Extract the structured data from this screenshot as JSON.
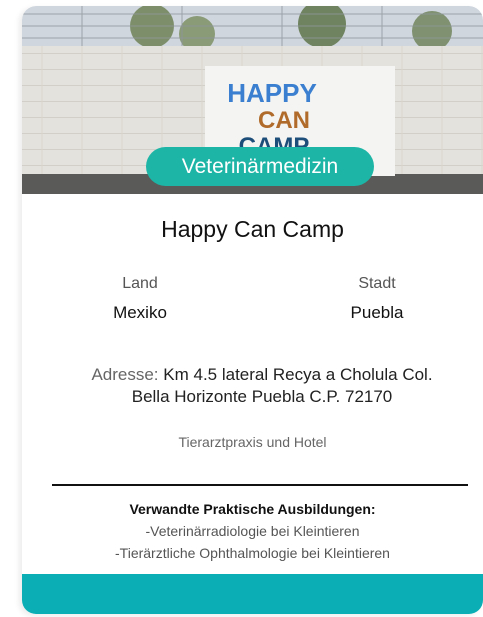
{
  "hero": {
    "sign_lines": [
      "HAPPY",
      "CAN",
      "CAMP"
    ],
    "badge_label": "Veterinärmedizin"
  },
  "title": "Happy Can Camp",
  "details": {
    "country_label": "Land",
    "country_value": "Mexiko",
    "city_label": "Stadt",
    "city_value": "Puebla"
  },
  "address": {
    "label": "Adresse:",
    "line1": "Km 4.5 lateral Recya a Cholula Col.",
    "line2": "Bella Horizonte Puebla C.P. 72170"
  },
  "practice_type": "Tierarztpraxis und Hotel",
  "related": {
    "title": "Verwandte Praktische Ausbildungen:",
    "items": [
      "-Veterinärradiologie bei Kleintieren",
      "-Tierärztliche Ophthalmologie bei Kleintieren"
    ]
  },
  "colors": {
    "accent": "#1db5a6",
    "footer": "#0aaeb4"
  }
}
